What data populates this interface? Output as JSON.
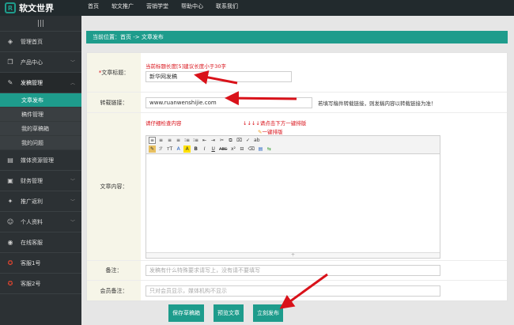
{
  "brand": {
    "mark": "R",
    "name": "软文世界"
  },
  "topnav": [
    "首页",
    "软文推广",
    "营销学堂",
    "帮助中心",
    "联系我们"
  ],
  "sidebar": {
    "toggle": "|||",
    "items": [
      {
        "label": "管理首页",
        "icon": "dashboard-icon",
        "glyph": "◈"
      },
      {
        "label": "产品中心",
        "icon": "cube-icon",
        "glyph": "❒"
      },
      {
        "label": "发稿管理",
        "icon": "edit-icon",
        "glyph": "✎"
      }
    ],
    "subitems": [
      "文章发布",
      "稿件管理",
      "我的草稿箱",
      "我的问题"
    ],
    "items2": [
      {
        "label": "媒体资源管理",
        "icon": "media-icon",
        "glyph": "▤"
      },
      {
        "label": "财务管理",
        "icon": "wallet-icon",
        "glyph": "▣"
      },
      {
        "label": "推广返利",
        "icon": "tag-icon",
        "glyph": "✦"
      },
      {
        "label": "个人资料",
        "icon": "user-icon",
        "glyph": "☺"
      },
      {
        "label": "在线客服",
        "icon": "chat-icon",
        "glyph": "◉"
      },
      {
        "label": "客服1号",
        "icon": "qq-icon",
        "glyph": "✪"
      },
      {
        "label": "客服2号",
        "icon": "qq-icon",
        "glyph": "✪"
      }
    ]
  },
  "breadcrumb": "当前位置：首页 -> 文章发布",
  "form": {
    "title": {
      "required_mark": "*",
      "label": "文章标题：",
      "hint": "当前标题长度[5]建议长度小于30字",
      "value": "新华网发稿"
    },
    "link": {
      "label": "转载链接：",
      "value": "www.ruanwenshijie.com",
      "note": "若填写稿件转载链接，则发稿内容以转载链接为准！"
    },
    "content": {
      "label": "文章内容：",
      "hint": "请仔细检查内容",
      "hint2": "↓↓↓↓请点击下方一键排版",
      "one_click": "一键排版",
      "toolbar_row1": [
        "≡",
        "≡",
        "≡",
        "≡",
        "⁝≡",
        "⁝≡",
        "⇤",
        "⇥",
        "✂",
        "⧉",
        "⌧",
        "✓",
        "ab"
      ],
      "toolbar_row2": [
        "✎",
        "ℱ",
        "тT",
        "A",
        "A",
        "B",
        "I",
        "U",
        "ABC",
        "x²",
        "⊟",
        "⌫",
        "▤",
        "⇆"
      ],
      "resize": "÷"
    },
    "remark": {
      "label": "备注：",
      "placeholder": "发稿有什么特殊要求请写上，没有请不要填写"
    },
    "member_remark": {
      "label": "会员备注：",
      "placeholder": "只对会员显示，媒体机构不显示"
    }
  },
  "buttons": {
    "draft": "保存草稿箱",
    "preview": "预览文章",
    "publish": "立刻发布"
  },
  "colors": {
    "accent": "#1e9c8c",
    "topbar": "#222a2d",
    "sidebar": "#2c3134",
    "hint": "#d9121a"
  }
}
